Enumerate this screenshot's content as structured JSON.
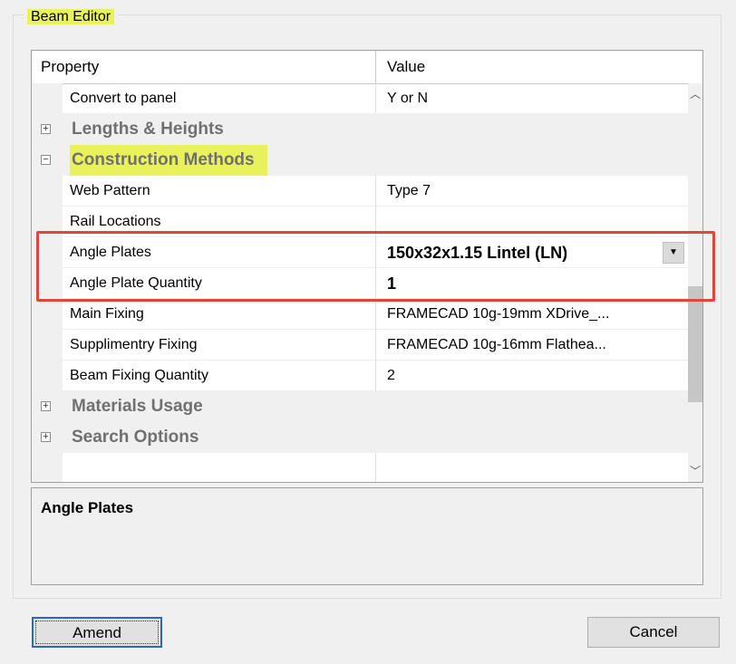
{
  "window": {
    "group_title": "Beam Editor"
  },
  "grid": {
    "headers": {
      "property": "Property",
      "value": "Value"
    },
    "rows": [
      {
        "kind": "prop",
        "name": "Convert to panel",
        "value": "Y or N"
      },
      {
        "kind": "category",
        "name": "Lengths & Heights",
        "expander": "+"
      },
      {
        "kind": "category",
        "name": "Construction Methods",
        "expander": "−"
      },
      {
        "kind": "prop",
        "name": "Web Pattern",
        "value": "Type 7"
      },
      {
        "kind": "prop",
        "name": "Rail Locations",
        "value": ""
      },
      {
        "kind": "prop",
        "name": "Angle Plates",
        "value": "150x32x1.15 Lintel  (LN)"
      },
      {
        "kind": "prop",
        "name": "Angle Plate Quantity",
        "value": "1"
      },
      {
        "kind": "prop",
        "name": "Main Fixing",
        "value": "FRAMECAD 10g-19mm XDrive_..."
      },
      {
        "kind": "prop",
        "name": "Supplimentry Fixing",
        "value": "FRAMECAD 10g-16mm Flathea..."
      },
      {
        "kind": "prop",
        "name": "Beam Fixing Quantity",
        "value": "2"
      },
      {
        "kind": "category",
        "name": "Materials Usage",
        "expander": "+"
      },
      {
        "kind": "category",
        "name": "Search Options",
        "expander": "+"
      }
    ],
    "scroll": {
      "up": "▲",
      "down": "▼",
      "position_fraction": 0.55
    }
  },
  "description": {
    "title": "Angle Plates"
  },
  "buttons": {
    "amend": "Amend",
    "cancel": "Cancel"
  },
  "colors": {
    "highlight": "#e9f25a",
    "annotation_box": "#e0463f",
    "focus_border": "#2a68c5"
  }
}
